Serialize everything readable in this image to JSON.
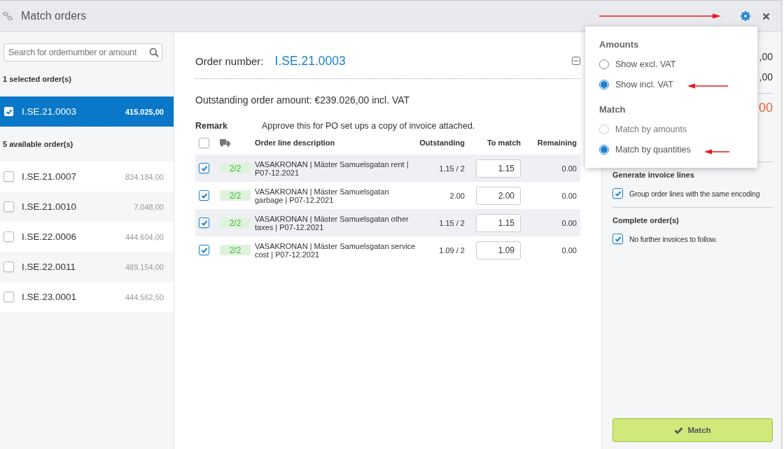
{
  "window": {
    "title": "Match orders"
  },
  "sidebar": {
    "search": {
      "placeholder": "Search for ordernumber or amount"
    },
    "selected_heading": "1 selected order(s)",
    "selected_orders": [
      {
        "number": "I.SE.21.0003",
        "amount": "415.025,00",
        "checked": true,
        "selected": true
      }
    ],
    "available_heading": "5 available order(s)",
    "available_orders": [
      {
        "number": "I.SE.21.0007",
        "amount": "834.184,00",
        "checked": false,
        "selected": false
      },
      {
        "number": "I.SE.21.0010",
        "amount": "7.048,00",
        "checked": false,
        "selected": false
      },
      {
        "number": "I.SE.22.0006",
        "amount": "444.604,00",
        "checked": false,
        "selected": false
      },
      {
        "number": "I.SE.22.0011",
        "amount": "489.154,00",
        "checked": false,
        "selected": false
      },
      {
        "number": "I.SE.23.0001",
        "amount": "444.562,50",
        "checked": false,
        "selected": false
      }
    ]
  },
  "order": {
    "number_label": "Order number:",
    "number": "I.SE.21.0003",
    "outstanding": "Outstanding order amount: €239.026,00 incl. VAT",
    "remark_label": "Remark",
    "remark": "Approve this for PO set ups a copy of invoice attached.",
    "table": {
      "all_checked": false,
      "columns": [
        "Order line description",
        "Outstanding",
        "To match",
        "Remaining"
      ],
      "rows": [
        {
          "checked": true,
          "badge": "2/2",
          "description": "VASAKRONAN | Mäster Samuelsgatan rent | P07-12.2021",
          "outstanding": "1.15 / 2",
          "to_match": "1.15",
          "remaining": "0.00"
        },
        {
          "checked": true,
          "badge": "2/2",
          "description": "VASAKRONAN | Mäster Samuelsgatan garbage | P07-12.2021",
          "outstanding": "2.00",
          "to_match": "2.00",
          "remaining": "0.00"
        },
        {
          "checked": true,
          "badge": "2/2",
          "description": "VASAKRONAN | Mäster Samuelsgatan other taxes | P07-12.2021",
          "outstanding": "1.15 / 2",
          "to_match": "1.15",
          "remaining": "0.00"
        },
        {
          "checked": true,
          "badge": "2/2",
          "description": "VASAKRONAN | Mäster Samuelsgatan service cost | P07-12.2021",
          "outstanding": "1.09 / 2",
          "to_match": "1.09",
          "remaining": "0.00"
        }
      ]
    }
  },
  "summary": {
    "values": [
      ",00",
      ",00"
    ],
    "total": "00",
    "sections": [
      {
        "title": "Generate invoice lines",
        "options": [
          {
            "label": "Group order lines with the same encoding",
            "checked": true
          }
        ]
      },
      {
        "title": "Complete order(s)",
        "options": [
          {
            "label": "No further invoices to follow.",
            "checked": true
          }
        ]
      }
    ],
    "match_button": "Match"
  },
  "settings_menu": {
    "groups": [
      {
        "title": "Amounts",
        "options": [
          {
            "label": "Show excl. VAT",
            "selected": false,
            "disabled": false
          },
          {
            "label": "Show incl. VAT",
            "selected": true,
            "disabled": false
          }
        ]
      },
      {
        "title": "Match",
        "options": [
          {
            "label": "Match by amounts",
            "selected": false,
            "disabled": true
          },
          {
            "label": "Match by quantities",
            "selected": true,
            "disabled": false
          }
        ]
      }
    ]
  }
}
